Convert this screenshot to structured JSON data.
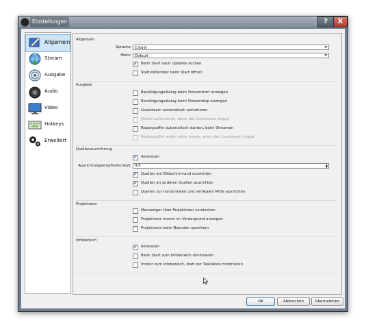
{
  "window": {
    "title": "Einstellungen",
    "help": "?",
    "close": "X"
  },
  "sidebar": {
    "items": [
      {
        "label": "Allgemein",
        "icon": "general-settings-icon"
      },
      {
        "label": "Stream",
        "icon": "globe-icon"
      },
      {
        "label": "Ausgabe",
        "icon": "output-icon"
      },
      {
        "label": "Audio",
        "icon": "speaker-icon"
      },
      {
        "label": "Video",
        "icon": "monitor-icon"
      },
      {
        "label": "Hotkeys",
        "icon": "keyboard-icon"
      },
      {
        "label": "Erweitert",
        "icon": "gears-icon"
      }
    ],
    "active": "Allgemein"
  },
  "general": {
    "title": "Allgemein",
    "language_label": "Sprache",
    "language_value": "Català",
    "theme_label": "Motiv",
    "theme_value": "Default",
    "check_updates": {
      "label": "Beim Start nach Updates suchen",
      "checked": true
    },
    "stats_window": {
      "label": "Statistikfenster beim Start öffnen",
      "checked": false
    }
  },
  "output": {
    "title": "Ausgabe",
    "confirm_start": {
      "label": "Bestätigungsdialog beim Streamstart anzeigen",
      "checked": false
    },
    "confirm_stop": {
      "label": "Bestätigungsdialog beim Streamstop anzeigen",
      "checked": false
    },
    "auto_record": {
      "label": "Livestream automatisch aufnehmen",
      "checked": false
    },
    "keep_recording": {
      "label": "Weiter aufnehmen, wenn der Livestream stoppt",
      "checked": false,
      "disabled": true
    },
    "replay_auto": {
      "label": "Replaypuffer automatisch starten, beim Streamen",
      "checked": false
    },
    "replay_keep": {
      "label": "Replaypuffer weiter aktiv lassen, wenn der Livestream stoppt",
      "checked": false,
      "disabled": true
    }
  },
  "snapping": {
    "title": "Quellenausrichtung",
    "enable": {
      "label": "Aktivieren",
      "checked": true
    },
    "sensitivity_label": "Ausrichtungsempfindlichkeit",
    "sensitivity_value": "9,0",
    "screen_edge": {
      "label": "Quellen am Bildschirmrand ausrichten",
      "checked": true
    },
    "other_sources": {
      "label": "Quellen an anderen Quellen ausrichten",
      "checked": true
    },
    "center": {
      "label": "Quellen zur horizontalen und vertikalen Mitte ausrichten",
      "checked": false
    }
  },
  "projectors": {
    "title": "Projektoren",
    "hide_cursor": {
      "label": "Mauszeiger über Projektoren verstecken",
      "checked": false
    },
    "always_top": {
      "label": "Projektoren immer im Vordergrund anzeigen",
      "checked": false
    },
    "save_on_exit": {
      "label": "Projektoren beim Beenden speichern",
      "checked": false
    }
  },
  "tray": {
    "title": "Infobereich",
    "enable": {
      "label": "Aktivieren",
      "checked": true
    },
    "minimize_start": {
      "label": "Beim Start zum Infobereich minimieren",
      "checked": false
    },
    "minimize_taskbar": {
      "label": "Immer zum Infobereich, statt zur Taskleiste minimieren",
      "checked": false
    }
  },
  "buttons": {
    "ok": "OK",
    "cancel": "Abbrechen",
    "apply": "Übernehmen"
  },
  "colors": {
    "selection": "#cde5f7",
    "checkmark": "#1e4e9a",
    "titlebar": "#7f8b96"
  }
}
